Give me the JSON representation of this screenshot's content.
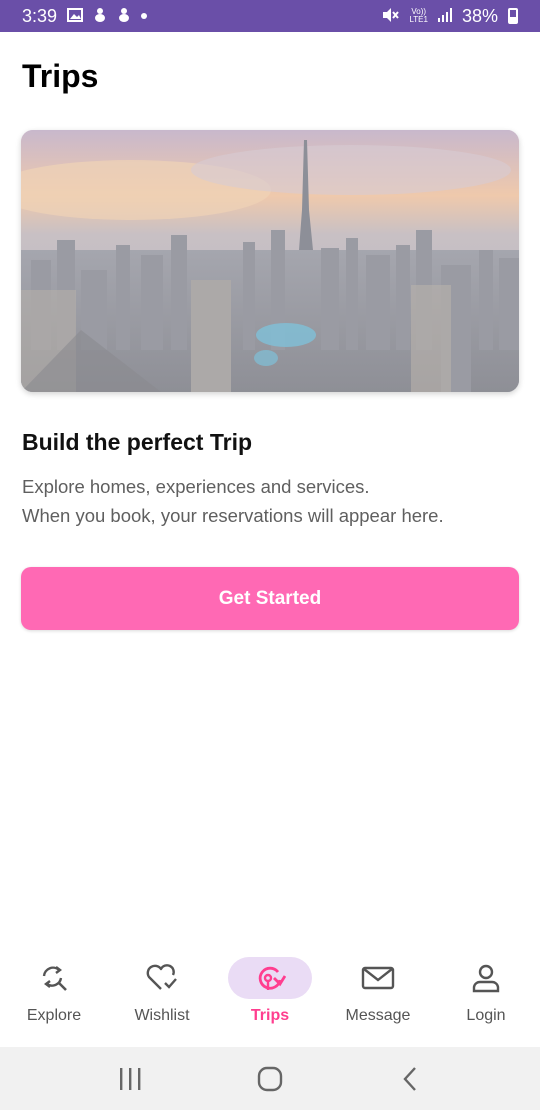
{
  "status_bar": {
    "time": "3:39",
    "left_icons": [
      "image-icon",
      "notification-icon",
      "notification-icon"
    ],
    "network": "LTE1",
    "network_top": "Vo))",
    "battery": "38%",
    "battery_level": 0.38
  },
  "page": {
    "title": "Trips"
  },
  "hero": {
    "image_name": "city-skyline-image"
  },
  "content": {
    "headline": "Build the perfect Trip",
    "description_line1": "Explore homes, experiences and services.",
    "description_line2": "When you book, your reservations will appear here.",
    "cta_label": "Get Started"
  },
  "bottom_nav": {
    "items": [
      {
        "label": "Explore",
        "icon": "explore-icon",
        "active": false
      },
      {
        "label": "Wishlist",
        "icon": "heart-check-icon",
        "active": false
      },
      {
        "label": "Trips",
        "icon": "trip-icon",
        "active": true
      },
      {
        "label": "Message",
        "icon": "mail-icon",
        "active": false
      },
      {
        "label": "Login",
        "icon": "user-icon",
        "active": false
      }
    ]
  },
  "colors": {
    "status_bar": "#6a4fa8",
    "accent": "#ff69b4",
    "active_label": "#ff3e8f",
    "active_pill": "#eadcf5"
  }
}
